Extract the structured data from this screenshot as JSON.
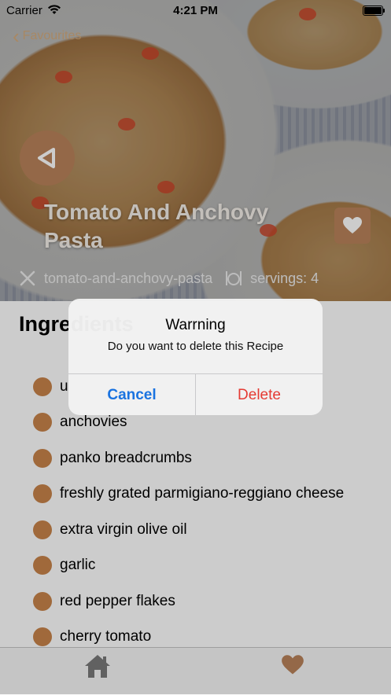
{
  "status_bar": {
    "carrier": "Carrier",
    "time": "4:21 PM"
  },
  "nav": {
    "back_label": "Favourites"
  },
  "recipe": {
    "title": "Tomato And Anchovy Pasta",
    "slug": "tomato-and-anchovy-pasta",
    "servings_label": "servings: 4"
  },
  "ingredients": {
    "heading": "Ingredients",
    "items": [
      "u",
      "anchovies",
      "panko breadcrumbs",
      "freshly grated parmigiano-reggiano cheese",
      "extra virgin olive oil",
      "garlic",
      "red pepper flakes",
      "cherry tomato"
    ]
  },
  "alert": {
    "title": "Warrning",
    "message": "Do you want to delete this Recipe",
    "cancel_label": "Cancel",
    "delete_label": "Delete"
  },
  "tab_bar": {
    "items": [
      {
        "icon": "home-icon"
      },
      {
        "icon": "heart-icon"
      }
    ]
  },
  "colors": {
    "accent": "#b9835a",
    "bullet": "#c9844a",
    "cancel": "#1a73e0",
    "delete": "#e53b33"
  }
}
